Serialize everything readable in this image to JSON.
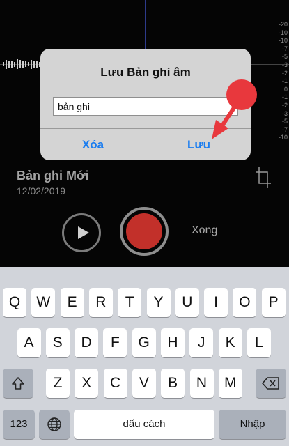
{
  "recorder": {
    "db_scale": [
      "-20",
      "-10",
      "-10",
      "-7",
      "-5",
      "-3",
      "-2",
      "-1",
      "0",
      "-1",
      "-2",
      "-3",
      "-5",
      "-7",
      "-10"
    ],
    "recording_title": "Bản ghi Mới",
    "recording_date": "12/02/2019",
    "done_label": "Xong"
  },
  "dialog": {
    "title": "Lưu Bản ghi âm",
    "input_value": "bản ghi",
    "delete_label": "Xóa",
    "save_label": "Lưu"
  },
  "keyboard": {
    "row1": [
      "Q",
      "W",
      "E",
      "R",
      "T",
      "Y",
      "U",
      "I",
      "O",
      "P"
    ],
    "row2": [
      "A",
      "S",
      "D",
      "F",
      "G",
      "H",
      "J",
      "K",
      "L"
    ],
    "row3": [
      "Z",
      "X",
      "C",
      "V",
      "B",
      "N",
      "M"
    ],
    "numbers_label": "123",
    "space_label": "dấu cách",
    "return_label": "Nhập"
  },
  "colors": {
    "accent": "#1a7df0",
    "record": "#c2302a",
    "annotation": "#e8383d"
  }
}
